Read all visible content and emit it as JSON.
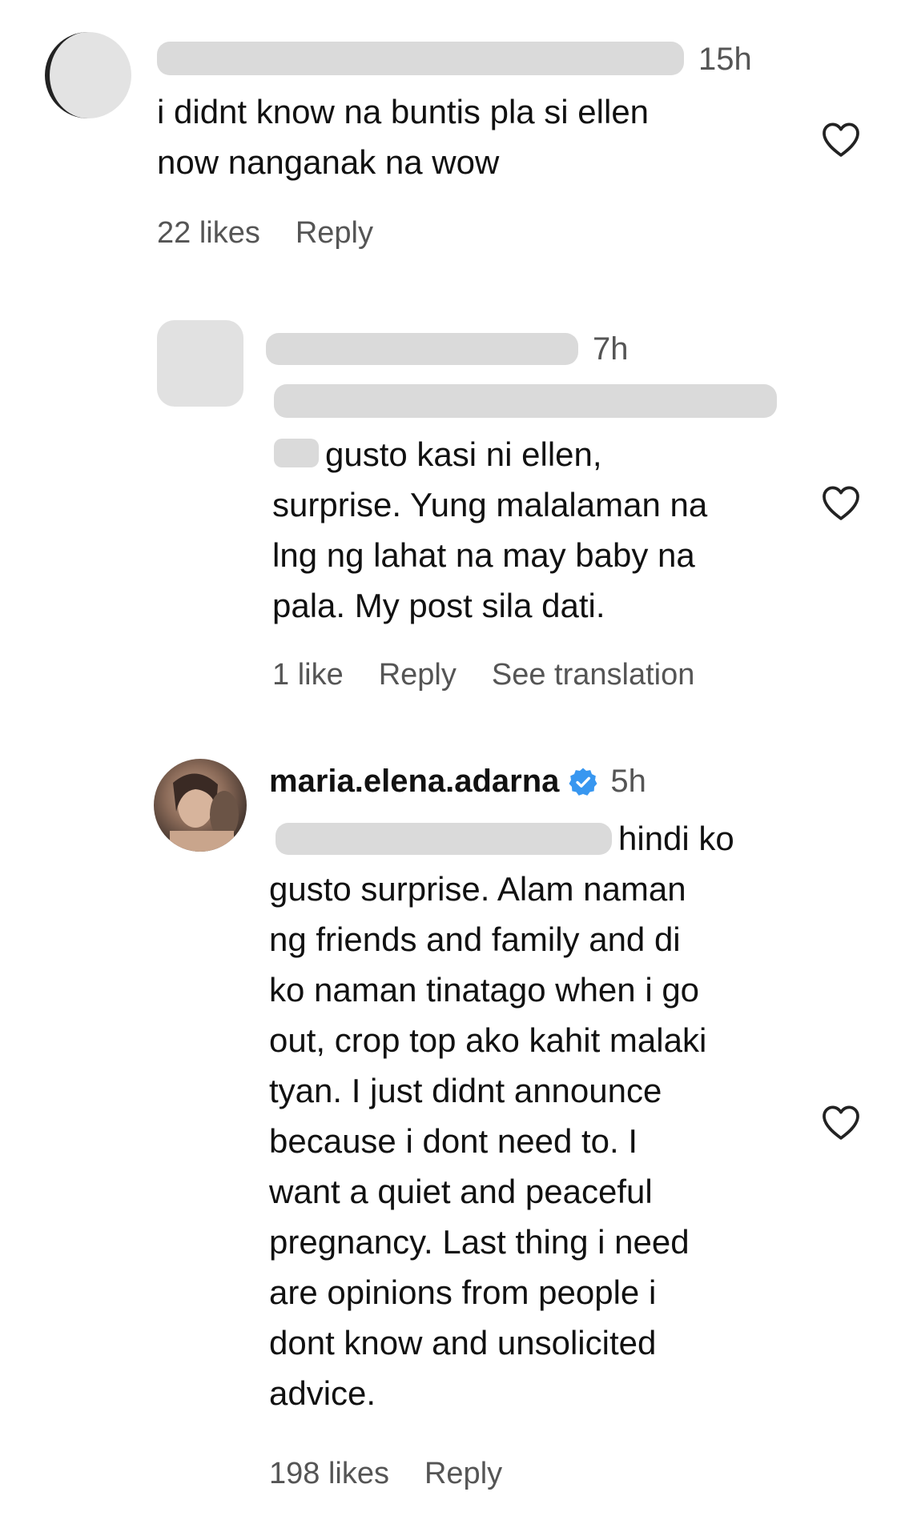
{
  "comments": [
    {
      "time": "15h",
      "text": "i didnt know na buntis pla si ellen\nnow nanganak na wow",
      "likes": "22 likes",
      "reply": "Reply"
    },
    {
      "time": "7h",
      "text_first": "gusto kasi ni ellen,",
      "text_rest": "surprise. Yung malalaman na\nlng ng lahat na may baby na\npala. My post sila dati.",
      "likes": "1 like",
      "reply": "Reply",
      "translation": "See translation"
    },
    {
      "username": "maria.elena.adarna",
      "verified": true,
      "time": "5h",
      "text_first": "hindi ko",
      "text_rest": "gusto surprise. Alam naman\nng friends and family and di\nko naman tinatago when i go\nout, crop top ako kahit malaki\ntyan. I just didnt announce\nbecause i dont need to. I\nwant a quiet and peaceful\npregnancy. Last thing i need\nare opinions from people i\ndont know and unsolicited\nadvice.",
      "likes": "198 likes",
      "reply": "Reply"
    }
  ],
  "icons": {
    "like": "heart-outline-icon",
    "verified": "verified-badge-icon"
  },
  "colors": {
    "verified": "#3897f0",
    "text": "#111111",
    "meta": "#555555"
  }
}
